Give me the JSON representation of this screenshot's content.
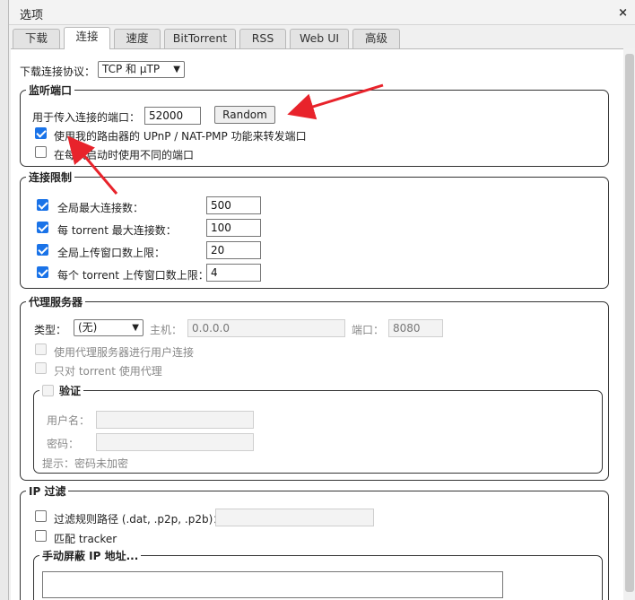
{
  "window": {
    "title": "选项",
    "close_glyph": "×"
  },
  "tabs": [
    "下载",
    "连接",
    "速度",
    "BitTorrent",
    "RSS",
    "Web UI",
    "高级"
  ],
  "active_tab": "连接",
  "protocol": {
    "label": "下载连接协议：",
    "value": "TCP 和 μTP"
  },
  "listen": {
    "legend": "监听端口",
    "port_label": "用于传入连接的端口：",
    "port_value": "52000",
    "random_button": "Random",
    "upnp_label": "使用我的路由器的 UPnP / NAT-PMP 功能来转发端口",
    "upnp_checked": true,
    "random_startup_label": "在每次启动时使用不同的端口",
    "random_startup_checked": false
  },
  "limits": {
    "legend": "连接限制",
    "rows": [
      {
        "label": "全局最大连接数：",
        "value": "500",
        "checked": true
      },
      {
        "label": "每 torrent 最大连接数：",
        "value": "100",
        "checked": true
      },
      {
        "label": "全局上传窗口数上限：",
        "value": "20",
        "checked": true
      },
      {
        "label": "每个 torrent 上传窗口数上限：",
        "value": "4",
        "checked": true
      }
    ]
  },
  "proxy": {
    "legend": "代理服务器",
    "type_label": "类型：",
    "type_value": "(无)",
    "host_label": "主机：",
    "host_value": "0.0.0.0",
    "port_label": "端口：",
    "port_value": "8080",
    "peer_label": "使用代理服务器进行用户连接",
    "torrent_only_label": "只对 torrent 使用代理",
    "auth": {
      "legend": "验证",
      "username_label": "用户名：",
      "password_label": "密码：",
      "hint": "提示：密码未加密"
    }
  },
  "ipfilter": {
    "legend": "IP 过滤",
    "path_label": "过滤规则路径 (.dat, .p2p, .p2b)：",
    "tracker_label": "匹配 tracker",
    "manual_legend": "手动屏蔽 IP 地址..."
  },
  "annotation_color": "#e8232b"
}
